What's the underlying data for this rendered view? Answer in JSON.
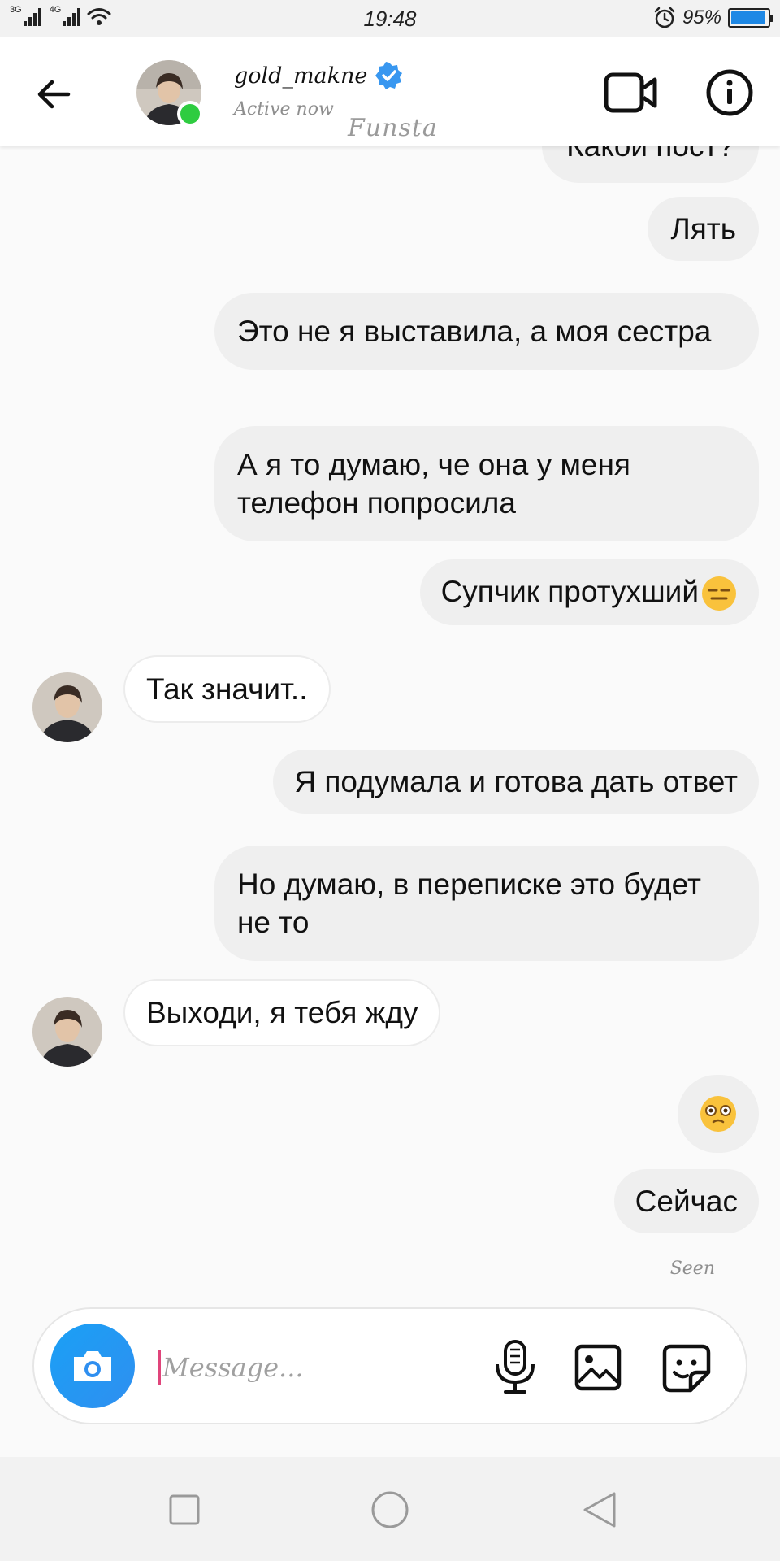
{
  "status_bar": {
    "network_1": "3G",
    "network_2": "4G",
    "time": "19:48",
    "battery_text": "95%",
    "battery_level": 0.95,
    "icons": [
      "signal-icon",
      "wifi-icon",
      "alarm-icon",
      "battery-icon"
    ]
  },
  "header": {
    "username": "gold_makne",
    "status": "Active now",
    "overlay_text": "Funsta",
    "icons": [
      "back-arrow-icon",
      "verified-badge-icon",
      "video-camera-icon",
      "info-icon"
    ]
  },
  "messages": [
    {
      "from": "me",
      "text": "Какой пост?"
    },
    {
      "from": "me",
      "text": "Лять"
    },
    {
      "from": "me",
      "text": "Это не я выставила, а моя сестра"
    },
    {
      "from": "me",
      "text": "А я то думаю, че она у меня телефон попросила"
    },
    {
      "from": "me",
      "text": "Супчик протухший",
      "emoji": "😑"
    },
    {
      "from": "them",
      "text": "Так значит.."
    },
    {
      "from": "me",
      "text": "Я подумала и готова дать ответ"
    },
    {
      "from": "me",
      "text": "Но думаю, в переписке это будет не то"
    },
    {
      "from": "them",
      "text": "Выходи, я тебя жду"
    },
    {
      "from": "me",
      "text": "",
      "emoji": "😳"
    },
    {
      "from": "me",
      "text": "Сейчас"
    }
  ],
  "seen_label": "Seen",
  "composer": {
    "placeholder": "Message...",
    "icons": [
      "camera-icon",
      "microphone-icon",
      "gallery-icon",
      "sticker-icon"
    ]
  },
  "nav_bar": {
    "icons": [
      "recents-icon",
      "home-icon",
      "back-icon"
    ]
  },
  "colors": {
    "accent_blue": "#2f8ff0",
    "online_green": "#2ecc40",
    "bubble_gray": "#efefef",
    "cursor_pink": "#e0457b"
  }
}
